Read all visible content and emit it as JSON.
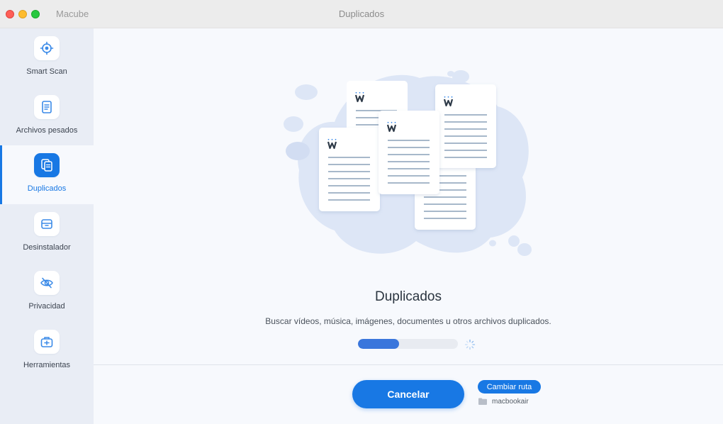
{
  "titlebar": {
    "app_name": "Macube",
    "window_title": "Duplicados"
  },
  "sidebar": {
    "items": [
      {
        "label": "Smart Scan",
        "icon": "target-icon",
        "active": false
      },
      {
        "label": "Archivos pesados",
        "icon": "file-icon",
        "active": false
      },
      {
        "label": "Duplicados",
        "icon": "duplicate-files-icon",
        "active": true
      },
      {
        "label": "Desinstalador",
        "icon": "box-icon",
        "active": false
      },
      {
        "label": "Privacidad",
        "icon": "eye-off-icon",
        "active": false
      },
      {
        "label": "Herramientas",
        "icon": "toolbox-icon",
        "active": false
      }
    ]
  },
  "main": {
    "heading": "Duplicados",
    "description": "Buscar vídeos, música, imágenes, documentes u otros archivos duplicados.",
    "progress_percent": 41,
    "cancel_label": "Cancelar",
    "change_path_label": "Cambiar ruta",
    "path_name": "macbookair"
  },
  "colors": {
    "accent": "#1878e4",
    "progress_fill": "#3a76dc",
    "sidebar_bg": "#e9edf5",
    "blob": "#dde6f6"
  }
}
